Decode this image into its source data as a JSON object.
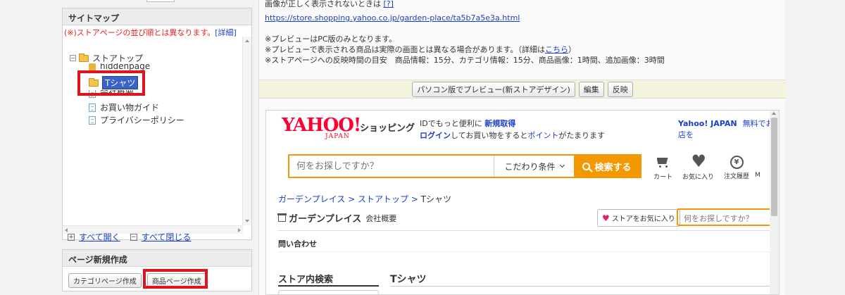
{
  "sitemap": {
    "title": "サイトマップ",
    "note": "(※)ストアページの並び順とは異なります。",
    "note_link": "[詳細]",
    "tree": {
      "root": "ストアトップ",
      "items": [
        "hiddenpage",
        "Tシャツ",
        "会社概要",
        "お買い物ガイド",
        "プライバシーポリシー"
      ]
    },
    "expand_all": "すべて開く",
    "collapse_all": "すべて閉じる"
  },
  "new_page": {
    "title": "ページ新規作成",
    "category_button": "カテゴリページ作成",
    "product_button": "商品ページ作成"
  },
  "info": {
    "line1": "画像が正しく表示されないときは",
    "line1_link": "[?]",
    "url": "https://store.shopping.yahoo.co.jp/garden-place/ta5b7a5e3a.html",
    "notice1": "※プレビューはPC版のみとなります。",
    "notice2_a": "※プレビューで表示される商品は実際の画面とは異なる場合があります。（詳細は",
    "notice2_link": "こちら",
    "notice2_b": "）",
    "notice3": "※ストアページへの反映時間の目安　商品情報：15分、カテゴリ情報：15分、商品画像：1時間、追加画像：3時間"
  },
  "toolbar": {
    "preview_button": "パソコン版でプレビュー(新ストアデザイン)",
    "edit_button": "編集",
    "publish_button": "反映"
  },
  "preview": {
    "logo_main": "YAHOO!",
    "logo_sub": "JAPAN",
    "shop_label": "ショッピング",
    "login_a": "IDでもっと便利に",
    "login_link1": "新規取得",
    "login_link2": "ログイン",
    "login_b": "してお買い物をすると",
    "login_link3": "ポイント",
    "login_c": "がたまります",
    "yjapan": "Yahoo! JAPAN",
    "free_store": "無料でお店を",
    "search_placeholder": "何をお探しですか？",
    "condition": "こだわり条件",
    "search_button": "検索する",
    "nav": [
      "カート",
      "お気に入り",
      "注文履歴",
      "M"
    ],
    "history_glyph": "¥",
    "breadcrumb": [
      "ガーデンプレイス",
      "ストアトップ",
      "Tシャツ"
    ],
    "breadcrumb_sep": " > ",
    "store_name": "ガーデンプレイス",
    "store_sub": "会社概要",
    "fav_button": "ストアをお気に入り",
    "store_search_placeholder": "何をお探しですか？",
    "contact": "問い合わせ",
    "store_search_heading": "ストア内検索",
    "page_heading": "Tシャツ"
  },
  "colors": {
    "highlight_red": "#e0141e",
    "yahoo_red": "#ff0033",
    "search_orange": "#f39800",
    "link_blue": "#1a3fc9"
  }
}
